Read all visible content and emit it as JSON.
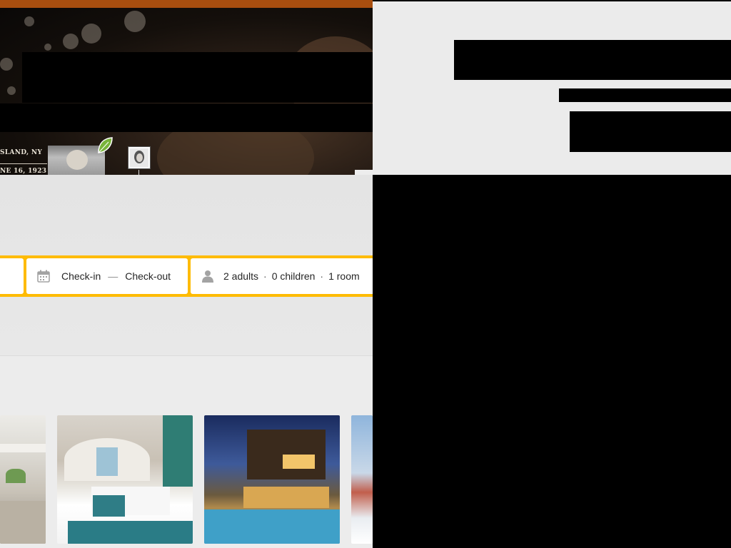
{
  "hero": {
    "caption_line1": "SLAND, NY",
    "caption_line2": "NE 16, 1923"
  },
  "search": {
    "checkin_label": "Check-in",
    "dash": "—",
    "checkout_label": "Check-out",
    "adults": "2 adults",
    "children": "0 children",
    "rooms": "1 room",
    "separator": "·",
    "accent_color": "#febb02"
  },
  "colors": {
    "top_bar": "#a84e0f",
    "background": "#ededed"
  },
  "icons": {
    "calendar": "calendar-icon",
    "person": "person-icon",
    "leaf": "leaf-icon"
  },
  "gallery": {
    "items": [
      "kitchen",
      "bedroom",
      "modern-villa-pool",
      "resort"
    ]
  }
}
